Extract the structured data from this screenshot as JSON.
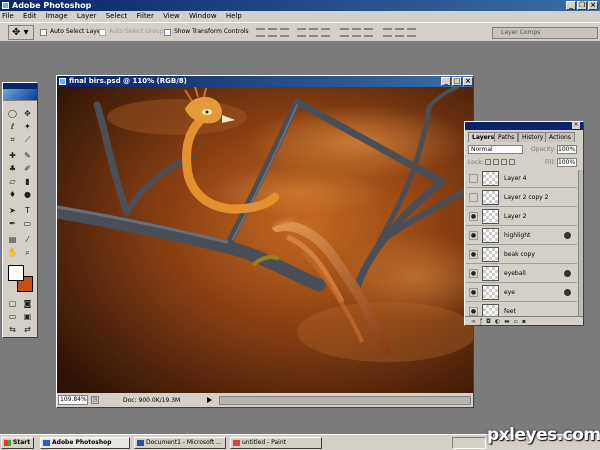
{
  "app": {
    "title": "Adobe Photoshop"
  },
  "menu": [
    "File",
    "Edit",
    "Image",
    "Layer",
    "Select",
    "Filter",
    "View",
    "Window",
    "Help"
  ],
  "options": {
    "auto_select_layer": "Auto Select Layer",
    "auto_select_groups": "Auto Select Groups",
    "show_transform_controls": "Show Transform Controls",
    "palette_well_tab": "Layer Comps"
  },
  "document": {
    "title": "final birs.psd @ 110% (RGB/8)",
    "zoom": "109.84%",
    "doc_size": "Doc: 900.0K/19.3M"
  },
  "colors": {
    "foreground": "#ffffff",
    "background": "#c4511c",
    "title_bar": "#0a246a"
  },
  "layers_panel": {
    "tabs": [
      "Layers",
      "Paths",
      "History",
      "Actions"
    ],
    "blend_mode": "Normal",
    "opacity_label": "Opacity:",
    "opacity_value": "100%",
    "lock_label": "Lock:",
    "fill_label": "Fill:",
    "fill_value": "100%",
    "layers": [
      {
        "name": "Layer 4",
        "visible": false,
        "fx": false
      },
      {
        "name": "Layer 2 copy 2",
        "visible": false,
        "fx": false
      },
      {
        "name": "Layer 2",
        "visible": true,
        "fx": false
      },
      {
        "name": "highlight",
        "visible": true,
        "fx": true
      },
      {
        "name": "beak copy",
        "visible": true,
        "fx": false
      },
      {
        "name": "eyeball",
        "visible": true,
        "fx": true
      },
      {
        "name": "eye",
        "visible": true,
        "fx": true
      },
      {
        "name": "feet",
        "visible": true,
        "fx": false
      }
    ]
  },
  "taskbar": {
    "start": "Start",
    "items": [
      "Adobe Photoshop",
      "Document1 - Microsoft ...",
      "untitled - Paint"
    ]
  },
  "watermark": "pxleyes.com"
}
